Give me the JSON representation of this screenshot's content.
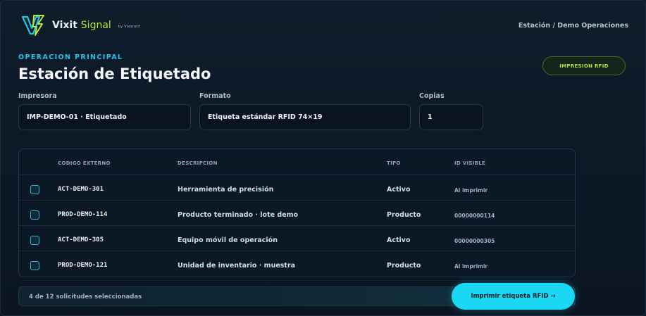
{
  "header": {
    "brand_word1": "Vixit",
    "brand_word2": "Signal",
    "byline": "· by Vixerant",
    "breadcrumb": "Estación / Demo Operaciones"
  },
  "page": {
    "overline": "OPERACION PRINCIPAL",
    "title": "Estación de Etiquetado",
    "mode_badge": "IMPRESION RFID"
  },
  "form": {
    "printer_label": "Impresora",
    "printer_value": "IMP-DEMO-01 · Etiquetado",
    "format_label": "Formato",
    "format_value": "Etiqueta estándar RFID 74×19",
    "copies_label": "Copias",
    "copies_value": "1"
  },
  "table": {
    "columns": [
      "CODIGO EXTERNO",
      "DESCRIPCION",
      "TIPO",
      "ID VISIBLE"
    ],
    "rows": [
      {
        "code": "ACT-DEMO-301",
        "desc": "Herramienta de precisión",
        "tipo": "Activo",
        "id": "Al imprimir"
      },
      {
        "code": "PROD-DEMO-114",
        "desc": "Producto terminado · lote demo",
        "tipo": "Producto",
        "id": "00000000114"
      },
      {
        "code": "ACT-DEMO-305",
        "desc": "Equipo móvil de operación",
        "tipo": "Activo",
        "id": "00000000305"
      },
      {
        "code": "PROD-DEMO-121",
        "desc": "Unidad de inventario · muestra",
        "tipo": "Producto",
        "id": "Al imprimir"
      }
    ]
  },
  "footer": {
    "selection_text": "4 de 12 solicitudes seleccionadas",
    "print_button": "Imprimir etiqueta RFID →"
  },
  "colors": {
    "accent_cyan": "#1ad8f2",
    "accent_lime": "#b9e62a",
    "background": "#0d1826"
  }
}
